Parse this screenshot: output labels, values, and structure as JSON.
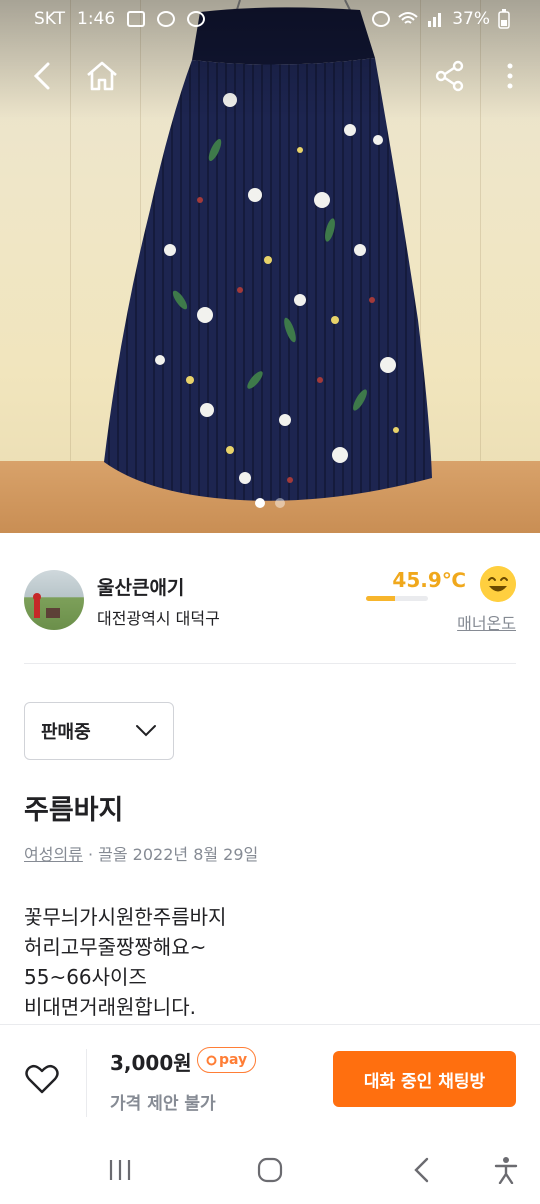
{
  "status_bar": {
    "carrier": "SKT",
    "time": "1:46",
    "battery": "37%",
    "left_icons": [
      "gallery-icon",
      "lock-notification-icon",
      "chat-bubble-icon"
    ],
    "right_icons": [
      "alarm-icon",
      "wifi-icon",
      "signal-icon",
      "battery-icon"
    ]
  },
  "nav": {
    "icons": [
      "back-arrow-icon",
      "home-icon",
      "share-icon",
      "more-vertical-icon"
    ]
  },
  "photo": {
    "carousel_count": 2,
    "active_index": 0
  },
  "seller": {
    "name": "울산큰애기",
    "location": "대전광역시 대덕구",
    "manner_temp": "45.9℃",
    "manner_temp_level": 0.46,
    "manner_label": "매너온도"
  },
  "sale_status": {
    "selected": "판매중"
  },
  "post": {
    "title": "주름바지",
    "category": "여성의류",
    "meta_rest": " · 끌올 2022년 8월 29일",
    "description": "꽃무늬가시원한주름바지\n허리고무줄짱짱해요~\n55~66사이즈\n비대면거래원합니다."
  },
  "action_bar": {
    "price": "3,000원",
    "pay_badge": "pay",
    "price_offer": "가격 제안 불가",
    "chat_button": "대화 중인 채팅방"
  },
  "colors": {
    "brand_orange": "#ff6f0f",
    "temp_yellow": "#f0a81c",
    "gray_text": "#868b94"
  }
}
